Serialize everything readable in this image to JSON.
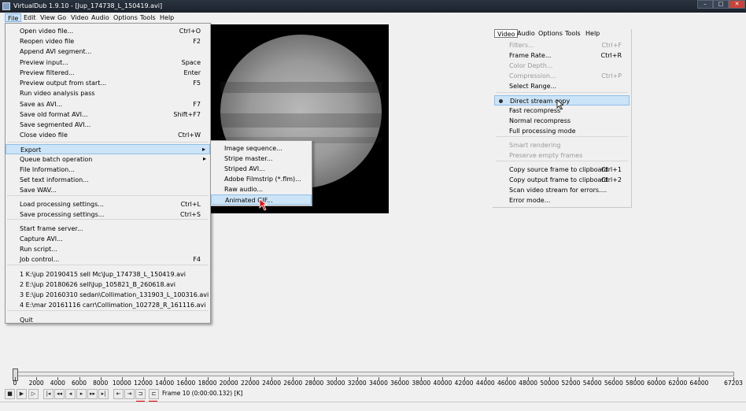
{
  "window": {
    "title": "VirtualDub 1.9.10 - [Jup_174738_L_150419.avi]",
    "minimize_glyph": "–",
    "maximize_glyph": "□",
    "close_glyph": "✕"
  },
  "menubar": [
    "File",
    "Edit",
    "View",
    "Go",
    "Video",
    "Audio",
    "Options",
    "Tools",
    "Help"
  ],
  "file_menu": [
    {
      "label": "Open video file...",
      "shortcut": "Ctrl+O"
    },
    {
      "label": "Reopen video file",
      "shortcut": "F2"
    },
    {
      "label": "Append AVI segment...",
      "shortcut": ""
    },
    {
      "label": "Preview input...",
      "shortcut": "Space"
    },
    {
      "label": "Preview filtered...",
      "shortcut": "Enter"
    },
    {
      "label": "Preview output from start...",
      "shortcut": "F5"
    },
    {
      "label": "Run video analysis pass",
      "shortcut": ""
    },
    {
      "label": "Save as AVI...",
      "shortcut": "F7"
    },
    {
      "label": "Save old format AVI...",
      "shortcut": "Shift+F7"
    },
    {
      "label": "Save segmented AVI...",
      "shortcut": ""
    },
    {
      "label": "Close video file",
      "shortcut": "Ctrl+W"
    },
    {
      "label": "Export",
      "shortcut": "",
      "submenu_arrow": "▸"
    },
    {
      "label": "Queue batch operation",
      "shortcut": "",
      "submenu_arrow": "▸"
    },
    {
      "label": "File Information...",
      "shortcut": ""
    },
    {
      "label": "Set text information...",
      "shortcut": ""
    },
    {
      "label": "Save WAV...",
      "shortcut": ""
    },
    {
      "label": "Load processing settings...",
      "shortcut": "Ctrl+L"
    },
    {
      "label": "Save processing settings...",
      "shortcut": "Ctrl+S"
    },
    {
      "label": "Start frame server...",
      "shortcut": ""
    },
    {
      "label": "Capture AVI...",
      "shortcut": ""
    },
    {
      "label": "Run script...",
      "shortcut": ""
    },
    {
      "label": "Job control...",
      "shortcut": "F4"
    },
    {
      "label": "1 K:\\jup 20190415 sell Mc\\Jup_174738_L_150419.avi",
      "shortcut": ""
    },
    {
      "label": "2 E:\\jup 20180626 sell\\Jup_105821_B_260618.avi",
      "shortcut": ""
    },
    {
      "label": "3 E:\\jup 20160310 sedan\\Collimation_131903_L_100316.avi",
      "shortcut": ""
    },
    {
      "label": "4 E:\\mar 20161116 carr\\Collimation_102728_R_161116.avi",
      "shortcut": ""
    },
    {
      "label": "Quit",
      "shortcut": ""
    }
  ],
  "export_submenu": [
    "Image sequence...",
    "Stripe master...",
    "Striped AVI...",
    "Adobe Filmstrip (*.flm)...",
    "Raw audio...",
    "Animated GIF..."
  ],
  "video_menu": {
    "bar": [
      "Video",
      "Audio",
      "Options",
      "Tools",
      "Help"
    ],
    "items": [
      {
        "label": "Filters...",
        "shortcut": "Ctrl+F",
        "disabled": true
      },
      {
        "label": "Frame Rate...",
        "shortcut": "Ctrl+R",
        "disabled": false
      },
      {
        "label": "Color Depth...",
        "shortcut": "",
        "disabled": true
      },
      {
        "label": "Compression...",
        "shortcut": "Ctrl+P",
        "disabled": true
      },
      {
        "label": "Select Range...",
        "shortcut": "",
        "disabled": false
      },
      {
        "label": "Direct stream copy",
        "shortcut": "",
        "disabled": false,
        "selected": true
      },
      {
        "label": "Fast recompress",
        "shortcut": "",
        "disabled": false
      },
      {
        "label": "Normal recompress",
        "shortcut": "",
        "disabled": false
      },
      {
        "label": "Full processing mode",
        "shortcut": "",
        "disabled": false
      },
      {
        "label": "Smart rendering",
        "shortcut": "",
        "disabled": true
      },
      {
        "label": "Preserve empty frames",
        "shortcut": "",
        "disabled": true
      },
      {
        "label": "Copy source frame to clipboard",
        "shortcut": "Ctrl+1",
        "disabled": false
      },
      {
        "label": "Copy output frame to clipboard",
        "shortcut": "Ctrl+2",
        "disabled": false
      },
      {
        "label": "Scan video stream for errors....",
        "shortcut": "",
        "disabled": false
      },
      {
        "label": "Error mode...",
        "shortcut": "",
        "disabled": false
      }
    ]
  },
  "timeline": {
    "tick_labels": [
      "0",
      "2000",
      "4000",
      "6000",
      "8000",
      "10000",
      "12000",
      "14000",
      "16000",
      "18000",
      "20000",
      "22000",
      "24000",
      "26000",
      "28000",
      "30000",
      "32000",
      "34000",
      "36000",
      "38000",
      "40000",
      "42000",
      "44000",
      "46000",
      "48000",
      "50000",
      "52000",
      "54000",
      "56000",
      "58000",
      "60000",
      "62000",
      "64000",
      "67203"
    ],
    "frame_info": "Frame 10 (0:00:00.132) [K]",
    "current_frame": 10,
    "total_frames": 67203
  },
  "toolbar_buttons": [
    "stop",
    "play-input",
    "play-output",
    "start",
    "prev-key",
    "prev",
    "next",
    "next-key",
    "end",
    "scene-back",
    "scene-fwd",
    "mark-in",
    "mark-out",
    "set-in",
    "set-out"
  ],
  "colors": {
    "highlight": "#cce4f7",
    "title_bg": "#1b222c",
    "mark": "#e00000"
  }
}
